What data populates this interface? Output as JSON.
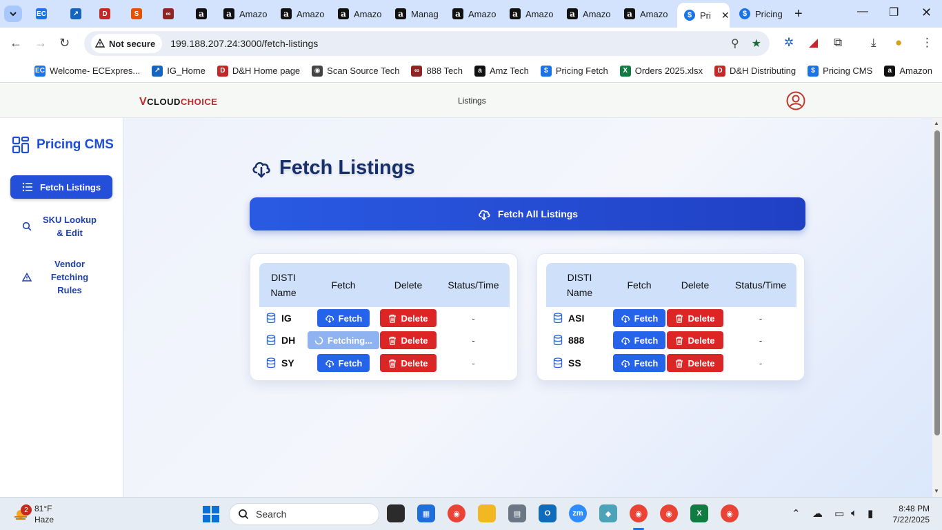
{
  "browser": {
    "tabs": [
      {
        "label": "",
        "icon": "ec-icon"
      },
      {
        "label": "",
        "icon": "arrow-app-icon"
      },
      {
        "label": "",
        "icon": "dh-icon"
      },
      {
        "label": "",
        "icon": "s-app-icon"
      },
      {
        "label": "",
        "icon": "888-icon"
      },
      {
        "label": "",
        "icon": "amazon-icon"
      },
      {
        "label": "Amazo",
        "icon": "amazon-icon"
      },
      {
        "label": "Amazo",
        "icon": "amazon-icon"
      },
      {
        "label": "Amazo",
        "icon": "amazon-icon"
      },
      {
        "label": "Manag",
        "icon": "amazon-icon"
      },
      {
        "label": "Amazo",
        "icon": "amazon-icon"
      },
      {
        "label": "Amazo",
        "icon": "amazon-icon"
      },
      {
        "label": "Amazo",
        "icon": "amazon-icon"
      },
      {
        "label": "Amazo",
        "icon": "amazon-icon"
      },
      {
        "label": "Pri",
        "icon": "dollar-icon",
        "active": true
      },
      {
        "label": "Pricing",
        "icon": "dollar-icon"
      }
    ],
    "security_label": "Not secure",
    "url": "199.188.207.24:3000/fetch-listings",
    "bookmarks": [
      {
        "label": "Welcome- ECExpres...",
        "color": "#1a73e8",
        "glyph": "EC"
      },
      {
        "label": "IG_Home",
        "color": "#1565c0",
        "glyph": "↗"
      },
      {
        "label": "D&H Home page",
        "color": "#c62828",
        "glyph": "D"
      },
      {
        "label": "Scan Source Tech",
        "color": "#444444",
        "glyph": "◉"
      },
      {
        "label": "888 Tech",
        "color": "#8e2424",
        "glyph": "∞"
      },
      {
        "label": "Amz Tech",
        "color": "#111111",
        "glyph": "a"
      },
      {
        "label": "Pricing Fetch",
        "color": "#1a73e8",
        "glyph": "$"
      },
      {
        "label": "Orders 2025.xlsx",
        "color": "#107c41",
        "glyph": "X"
      },
      {
        "label": "D&H Distributing",
        "color": "#c62828",
        "glyph": "D"
      },
      {
        "label": "Pricing CMS",
        "color": "#1a73e8",
        "glyph": "$"
      },
      {
        "label": "Amazon",
        "color": "#111111",
        "glyph": "a"
      }
    ]
  },
  "header": {
    "logo_v": "V",
    "logo_cloud": "CLOUD",
    "logo_choice": "CHOICE",
    "nav_label": "Listings"
  },
  "sidebar": {
    "brand": "Pricing CMS",
    "items": [
      {
        "label": "Fetch Listings",
        "icon": "list-icon",
        "active": true
      },
      {
        "label": "SKU Lookup & Edit",
        "icon": "search-icon"
      },
      {
        "label": "Vendor Fetching Rules",
        "icon": "warning-icon"
      }
    ]
  },
  "main": {
    "title": "Fetch Listings",
    "fetch_all_label": "Fetch All Listings",
    "columns": [
      "DISTI Name",
      "Fetch",
      "Delete",
      "Status/Time"
    ],
    "fetch_label": "Fetch",
    "fetching_label": "Fetching...",
    "delete_label": "Delete",
    "left_table": [
      {
        "name": "IG",
        "state": "idle",
        "status": "-"
      },
      {
        "name": "DH",
        "state": "fetching",
        "status": "-"
      },
      {
        "name": "SY",
        "state": "idle",
        "status": "-"
      }
    ],
    "right_table": [
      {
        "name": "ASI",
        "state": "idle",
        "status": "-"
      },
      {
        "name": "888",
        "state": "idle",
        "status": "-"
      },
      {
        "name": "SS",
        "state": "idle",
        "status": "-"
      }
    ]
  },
  "taskbar": {
    "weather_badge": "2",
    "temperature": "81°F",
    "condition": "Haze",
    "search_placeholder": "Search",
    "time": "8:48 PM",
    "date": "7/22/2025"
  },
  "colors": {
    "accent": "#2450d9",
    "delete": "#dc2626",
    "fetch": "#2563eb",
    "fetching": "#8fb2f0",
    "title": "#17306b"
  }
}
